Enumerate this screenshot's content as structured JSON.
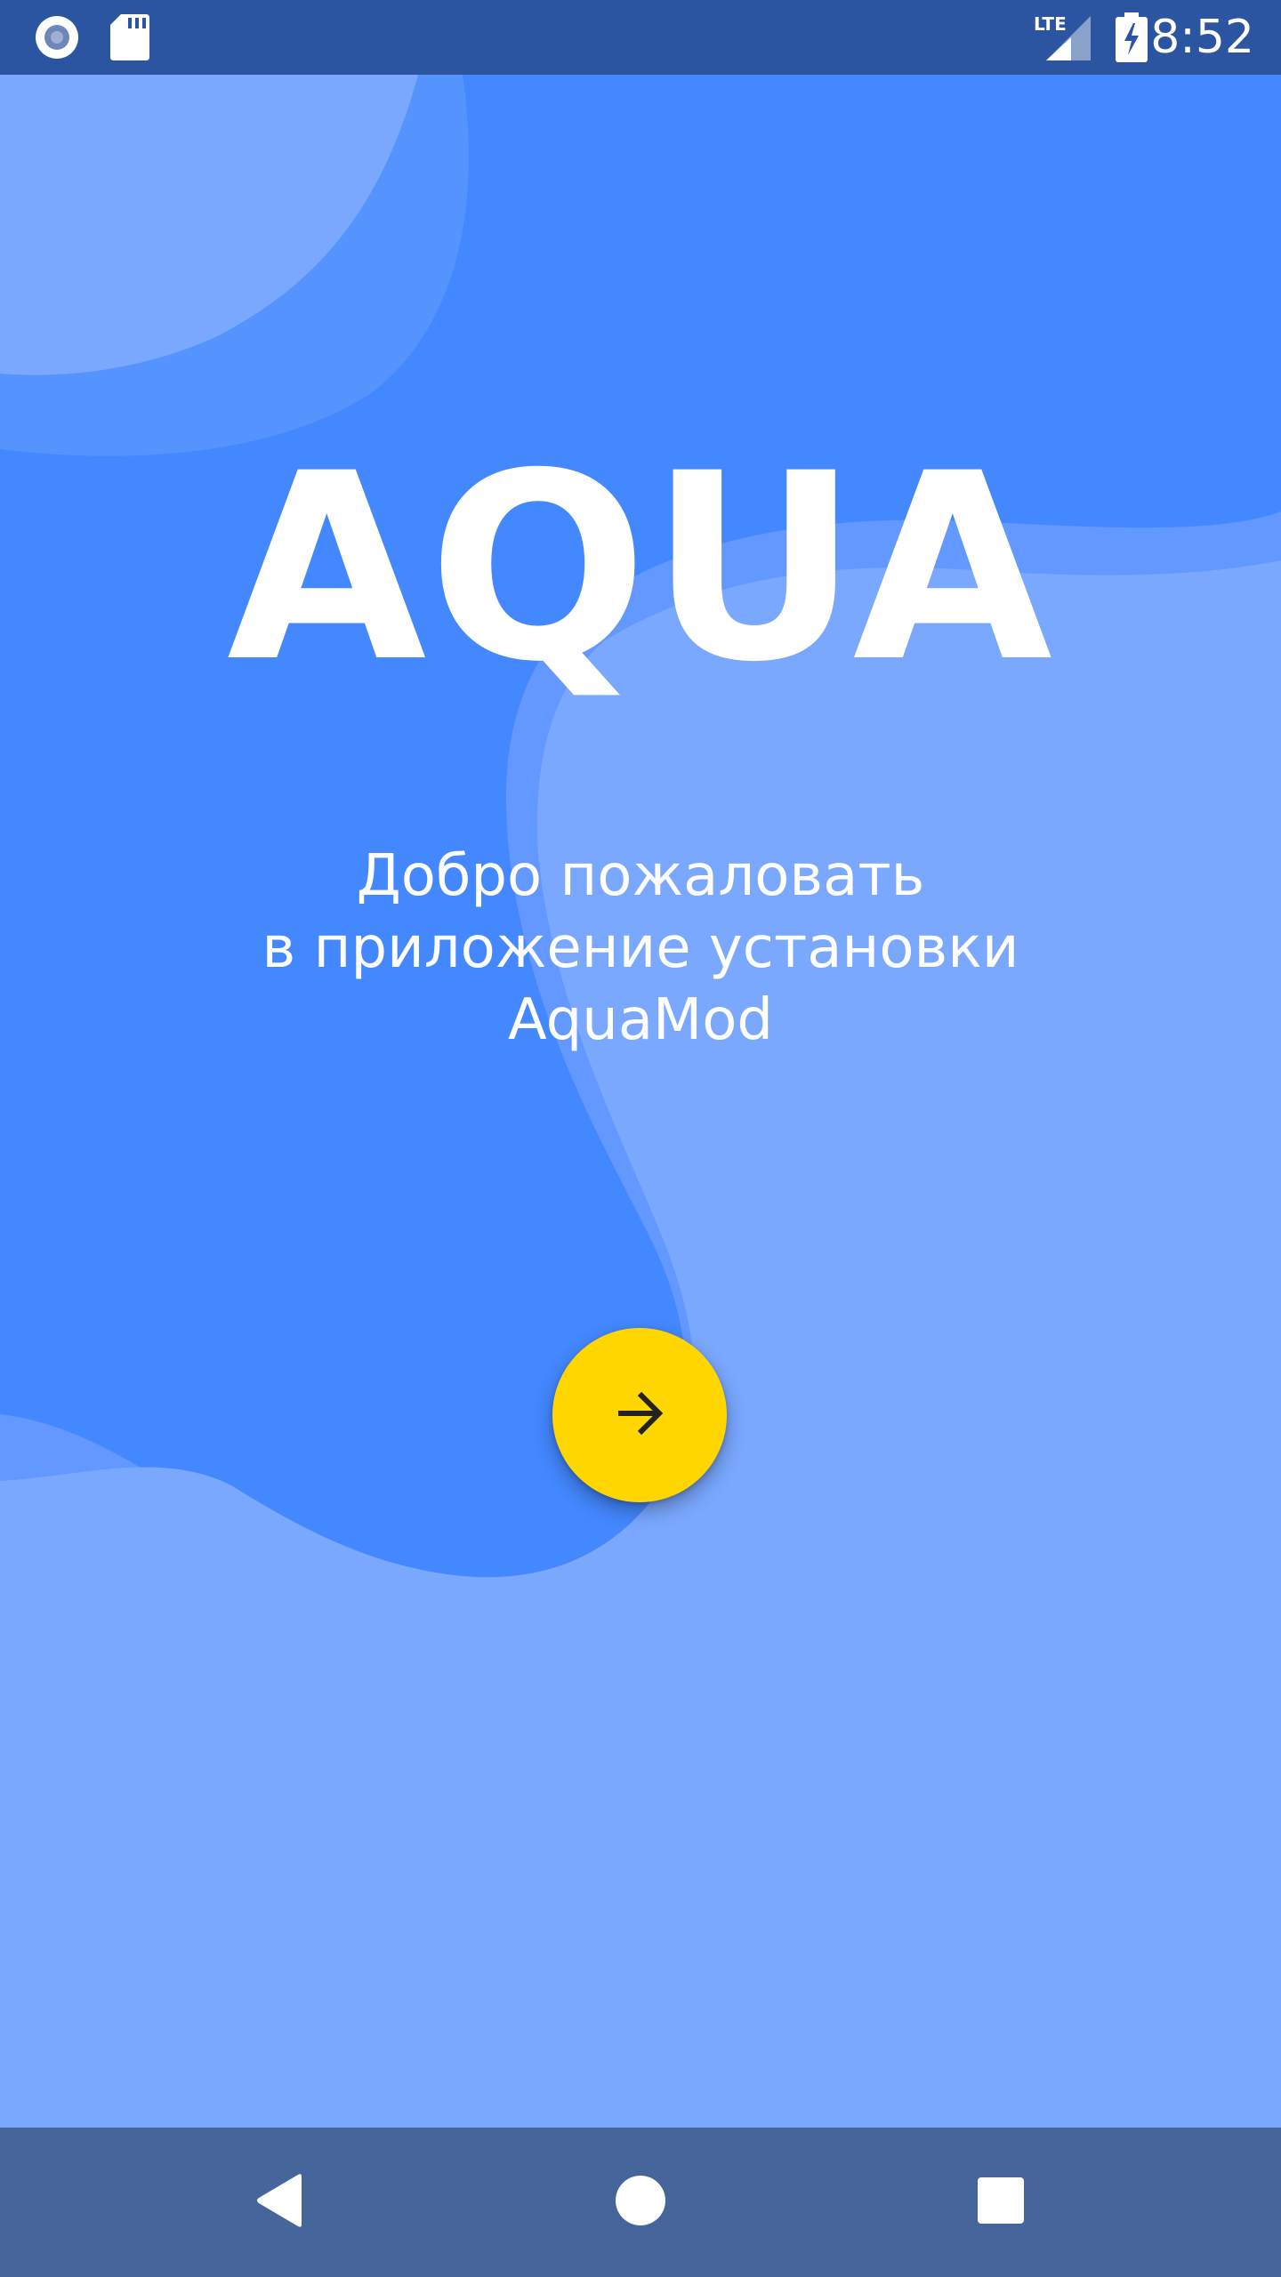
{
  "app": {
    "logo_text": "AQUA",
    "welcome_lines": [
      "Добро пожаловать",
      "в приложение установки",
      "AquaMod"
    ]
  },
  "status_bar": {
    "time": "8:52",
    "network": "LTE",
    "left_icons": [
      "record-icon",
      "sd-card-icon"
    ],
    "right_icons": [
      "lte-signal-icon",
      "battery-charging-icon"
    ]
  },
  "next_button": {
    "icon": "arrow-right-icon",
    "color": "#ffd600"
  },
  "nav_bar": {
    "buttons": [
      "back-icon",
      "home-icon",
      "recents-icon"
    ]
  },
  "colors": {
    "background_dark": "#4388ff",
    "background_light": "#7aa8ff",
    "status_bar": "#2b55a0",
    "nav_bar": "#46669b"
  }
}
